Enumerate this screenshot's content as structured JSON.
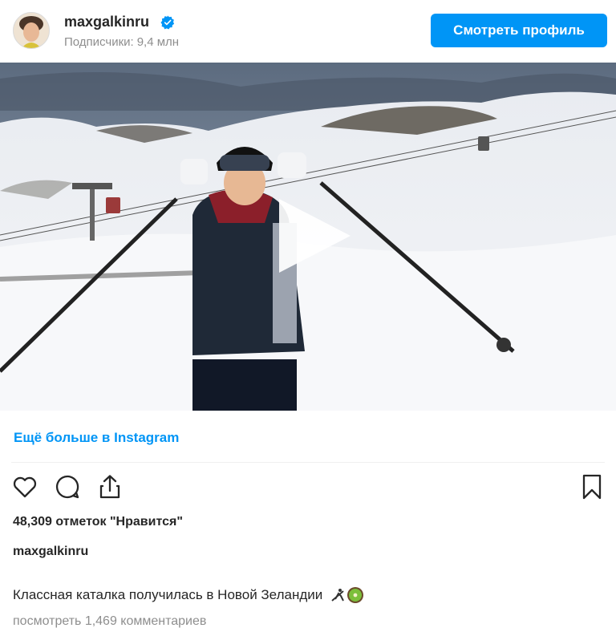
{
  "header": {
    "username": "maxgalkinru",
    "followers_label": "Подписчики:",
    "followers_count": "9,4 млн",
    "view_profile_label": "Смотреть профиль"
  },
  "media": {
    "type": "video",
    "play_icon": "play-icon",
    "scene": "skier on snowy slope with ski lifts"
  },
  "more_link": "Ещё больше в Instagram",
  "actions": {
    "like_icon": "heart-icon",
    "comment_icon": "comment-icon",
    "share_icon": "share-icon",
    "save_icon": "bookmark-icon"
  },
  "post": {
    "likes_text": "48,309 отметок \"Нравится\"",
    "caption_username": "maxgalkinru",
    "caption_text": "Классная каталка получилась в Новой Зеландии",
    "comments_link": "посмотреть 1,469 комментариев"
  },
  "colors": {
    "accent": "#0095f6",
    "text": "#262626",
    "secondary": "#8e8e8e"
  }
}
